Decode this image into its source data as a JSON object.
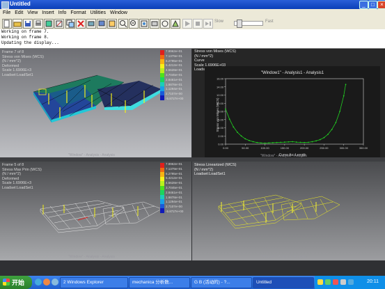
{
  "window": {
    "title": "Untitled",
    "min": "_",
    "max": "□",
    "close": "×"
  },
  "menu": [
    "File",
    "Edit",
    "View",
    "Insert",
    "Info",
    "Format",
    "Utilities",
    "Window"
  ],
  "toolbar": {
    "slow_label": "Slow",
    "fast_label": "Fast"
  },
  "messages": [
    "Working on frame 7.",
    "Working on frame 8.",
    "Updating the display..."
  ],
  "viewport_tl": {
    "lines": [
      "Frame 7 of 8",
      "Stress von Mises (WCS)",
      "(N / mm^2)",
      "Deformed",
      "Scale  1.6906E+3",
      "Loadset:LoadSet1"
    ],
    "legend_values": [
      "7.9962e+01",
      "7.1379e+01",
      "6.2795e+01",
      "5.4212e+01",
      "4.5628e+01",
      "3.7045e+01",
      "2.8461e+01",
      "1.9878e+01",
      "1.1294e+01",
      "2.7107e+00",
      "-5.8727e+00"
    ],
    "legend_colors": [
      "#e0201c",
      "#f06a10",
      "#f7b313",
      "#f6f11a",
      "#b9f01c",
      "#4de01c",
      "#1cd45c",
      "#1ccdb8",
      "#1a9fe6",
      "#1a5ad8",
      "#101ab8"
    ],
    "watermark": "\"Window\" - Analysis - Analysis"
  },
  "viewport_tr": {
    "lines": [
      "Stress von Mises (WCS)",
      "(N / mm^2)",
      "Curve",
      "Scale  1.6906E+03",
      "Loadset:LoadSet1"
    ],
    "watermark": "\"Window\" - Analysis - Analysis"
  },
  "chart_data": {
    "type": "line",
    "title": "\"Window1\" - Analysis1 - Analysis1",
    "xlabel": "Curve Arc Length",
    "ylabel": "Stress von Mises (WCS)",
    "x_ticks": [
      "0.00",
      "50.00",
      "100.00",
      "150.00",
      "200.00",
      "250.00",
      "300.00",
      "350.00"
    ],
    "y_ticks": [
      "0.00",
      "2.00",
      "4.00",
      "6.00",
      "8.00",
      "10.00",
      "12.00",
      "14.00",
      "16.00"
    ],
    "xlim": [
      0,
      350
    ],
    "ylim": [
      0,
      16
    ],
    "grid": false,
    "series": [
      {
        "color": "#22d022",
        "x": [
          0,
          10,
          20,
          30,
          40,
          50,
          60,
          70,
          80,
          90,
          100,
          110,
          120,
          130,
          140,
          150,
          160,
          170,
          180,
          190,
          200,
          210,
          220,
          230,
          240,
          250,
          260,
          270,
          280,
          290,
          300,
          305
        ],
        "y": [
          8.6,
          6.1,
          4.2,
          2.9,
          2.0,
          1.3,
          0.9,
          0.6,
          0.4,
          0.3,
          0.25,
          0.3,
          0.35,
          0.4,
          0.45,
          0.5,
          0.55,
          0.6,
          0.5,
          0.45,
          0.4,
          0.45,
          0.6,
          0.8,
          1.1,
          1.6,
          2.4,
          3.6,
          5.3,
          8.0,
          11.8,
          14.6
        ]
      }
    ]
  },
  "viewport_bl": {
    "lines": [
      "Frame 5 of 8",
      "Stress Max Prin (WCS)",
      "(N / mm^2)",
      "Deformed",
      "Scale  1.6906E+3",
      "Loadset:LoadSet1"
    ],
    "legend_values": [
      "7.9962e+01",
      "7.1379e+01",
      "6.2795e+01",
      "5.4212e+01",
      "4.5628e+01",
      "3.7045e+01",
      "2.8461e+01",
      "1.9878e+01",
      "1.1294e+01",
      "2.7107e+00",
      "-5.8727e+00"
    ],
    "watermark": "\"Window\" - Analysis - Analysis"
  },
  "viewport_br": {
    "lines": [
      "Stress Linearized (WCS)",
      "(N / mm^2)",
      "Loadset:LoadSet1"
    ],
    "watermark": "\"Window\" - Analysis - Analysis"
  },
  "taskbar": {
    "start_label": "开始",
    "tasks": [
      "2 Windows Explorer",
      "mechanica 分析数...",
      "G B (活动的) - ?...",
      "Untitled"
    ],
    "clock": "20:11"
  }
}
